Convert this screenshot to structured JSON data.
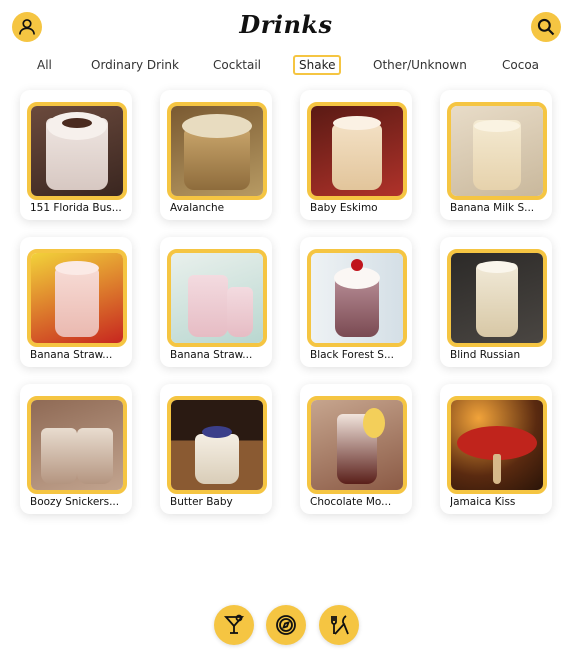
{
  "header": {
    "title": "Drinks",
    "profile_icon": "user-icon",
    "search_icon": "search-icon"
  },
  "colors": {
    "accent": "#f5c542",
    "background": "#ffffff",
    "text": "#111111"
  },
  "tabs": [
    {
      "label": "All",
      "active": false
    },
    {
      "label": "Ordinary Drink",
      "active": false
    },
    {
      "label": "Cocktail",
      "active": false
    },
    {
      "label": "Shake",
      "active": true
    },
    {
      "label": "Other/Unknown",
      "active": false
    },
    {
      "label": "Cocoa",
      "active": false
    }
  ],
  "drinks": [
    {
      "name": "151 Florida Bus..."
    },
    {
      "name": "Avalanche"
    },
    {
      "name": "Baby Eskimo"
    },
    {
      "name": "Banana Milk S..."
    },
    {
      "name": "Banana Straw..."
    },
    {
      "name": "Banana Straw..."
    },
    {
      "name": "Black Forest S..."
    },
    {
      "name": "Blind Russian"
    },
    {
      "name": "Boozy Snickers..."
    },
    {
      "name": "Butter Baby"
    },
    {
      "name": "Chocolate Mo..."
    },
    {
      "name": "Jamaica Kiss"
    }
  ],
  "bottom_nav": [
    {
      "icon": "cocktail-glass-icon"
    },
    {
      "icon": "compass-icon"
    },
    {
      "icon": "utensils-icon"
    }
  ]
}
